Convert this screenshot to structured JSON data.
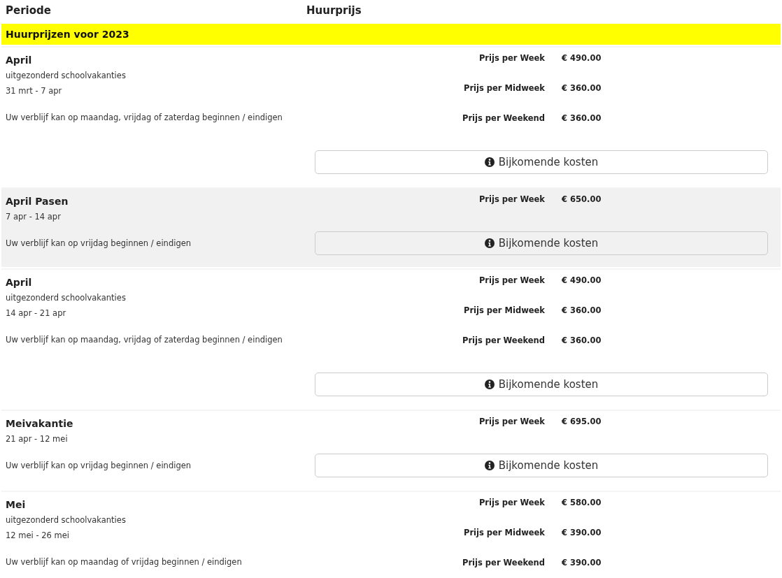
{
  "header": {
    "period": "Periode",
    "price": "Huurprijs"
  },
  "section": {
    "title": "Huurprijzen voor 2023"
  },
  "rows": [
    {
      "name": "April",
      "details": [
        "uitgezonderd schoolvakanties",
        "31 mrt - 7 apr"
      ],
      "note": "Uw verblijf kan op maandag, vrijdag of zaterdag beginnen / eindigen",
      "shaded": false,
      "prices": [
        {
          "label": "Prijs per Week",
          "amount": "€ 490.00"
        },
        {
          "label": "Prijs per Midweek",
          "amount": "€ 360.00"
        },
        {
          "label": "Prijs per Weekend",
          "amount": "€ 360.00"
        }
      ],
      "button": "Bijkomende kosten"
    },
    {
      "name": "April Pasen",
      "details": [
        "7 apr - 14 apr"
      ],
      "note": "Uw verblijf kan op vrijdag beginnen / eindigen",
      "shaded": true,
      "prices": [
        {
          "label": "Prijs per Week",
          "amount": "€ 650.00"
        }
      ],
      "button": "Bijkomende kosten"
    },
    {
      "name": "April",
      "details": [
        "uitgezonderd schoolvakanties",
        "14 apr - 21 apr"
      ],
      "note": "Uw verblijf kan op maandag, vrijdag of zaterdag beginnen / eindigen",
      "shaded": false,
      "prices": [
        {
          "label": "Prijs per Week",
          "amount": "€ 490.00"
        },
        {
          "label": "Prijs per Midweek",
          "amount": "€ 360.00"
        },
        {
          "label": "Prijs per Weekend",
          "amount": "€ 360.00"
        }
      ],
      "button": "Bijkomende kosten"
    },
    {
      "name": "Meivakantie",
      "details": [
        "21 apr - 12 mei"
      ],
      "note": "Uw verblijf kan op vrijdag beginnen / eindigen",
      "shaded": false,
      "prices": [
        {
          "label": "Prijs per Week",
          "amount": "€ 695.00"
        }
      ],
      "button": "Bijkomende kosten"
    },
    {
      "name": "Mei",
      "details": [
        "uitgezonderd schoolvakanties",
        "12 mei - 26 mei"
      ],
      "note": "Uw verblijf kan op maandag of vrijdag beginnen / eindigen",
      "shaded": false,
      "prices": [
        {
          "label": "Prijs per Week",
          "amount": "€ 580.00"
        },
        {
          "label": "Prijs per Midweek",
          "amount": "€ 390.00"
        },
        {
          "label": "Prijs per Weekend",
          "amount": "€ 390.00"
        }
      ]
    }
  ]
}
